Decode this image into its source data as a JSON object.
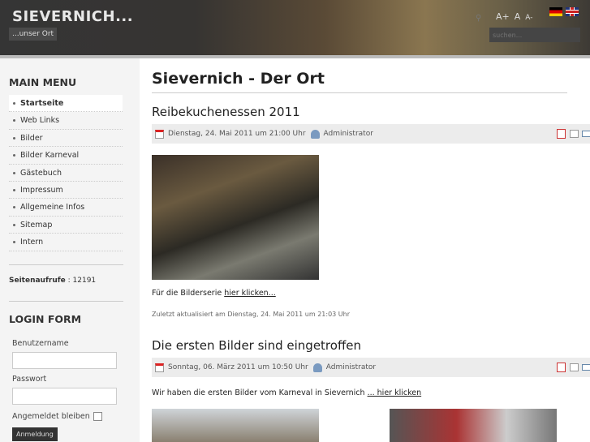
{
  "header": {
    "site_title": "SIEVERNICH...",
    "slogan": "...unser Ort",
    "font_controls": [
      "A+",
      "A",
      "A-"
    ],
    "search_placeholder": "suchen..."
  },
  "sidebar": {
    "main_menu_title": "MAIN MENU",
    "items": [
      "Startseite",
      "Web Links",
      "Bilder",
      "Bilder Karneval",
      "Gästebuch",
      "Impressum",
      "Allgemeine Infos",
      "Sitemap",
      "Intern"
    ],
    "stats_label": "Seitenaufrufe",
    "stats_value": ": 12191",
    "login_title": "LOGIN FORM",
    "username_label": "Benutzername",
    "password_label": "Passwort",
    "remember_label": "Angemeldet bleiben",
    "login_button": "Anmeldung"
  },
  "main": {
    "page_title": "Sievernich - Der Ort",
    "articles": [
      {
        "title": "Reibekuchenessen 2011",
        "date": "Dienstag, 24. Mai 2011 um 21:00 Uhr",
        "author": "Administrator",
        "text": "Für die Bilderserie ",
        "link": "hier klicken...",
        "updated": "Zuletzt aktualisiert am Dienstag, 24. Mai 2011 um 21:03 Uhr"
      },
      {
        "title": "Die ersten Bilder sind eingetroffen",
        "date": "Sonntag, 06. März 2011 um 10:50 Uhr",
        "author": "Administrator",
        "text": "Wir haben die ersten Bilder vom Karneval in Sievernich ",
        "link": "... hier klicken"
      }
    ]
  }
}
